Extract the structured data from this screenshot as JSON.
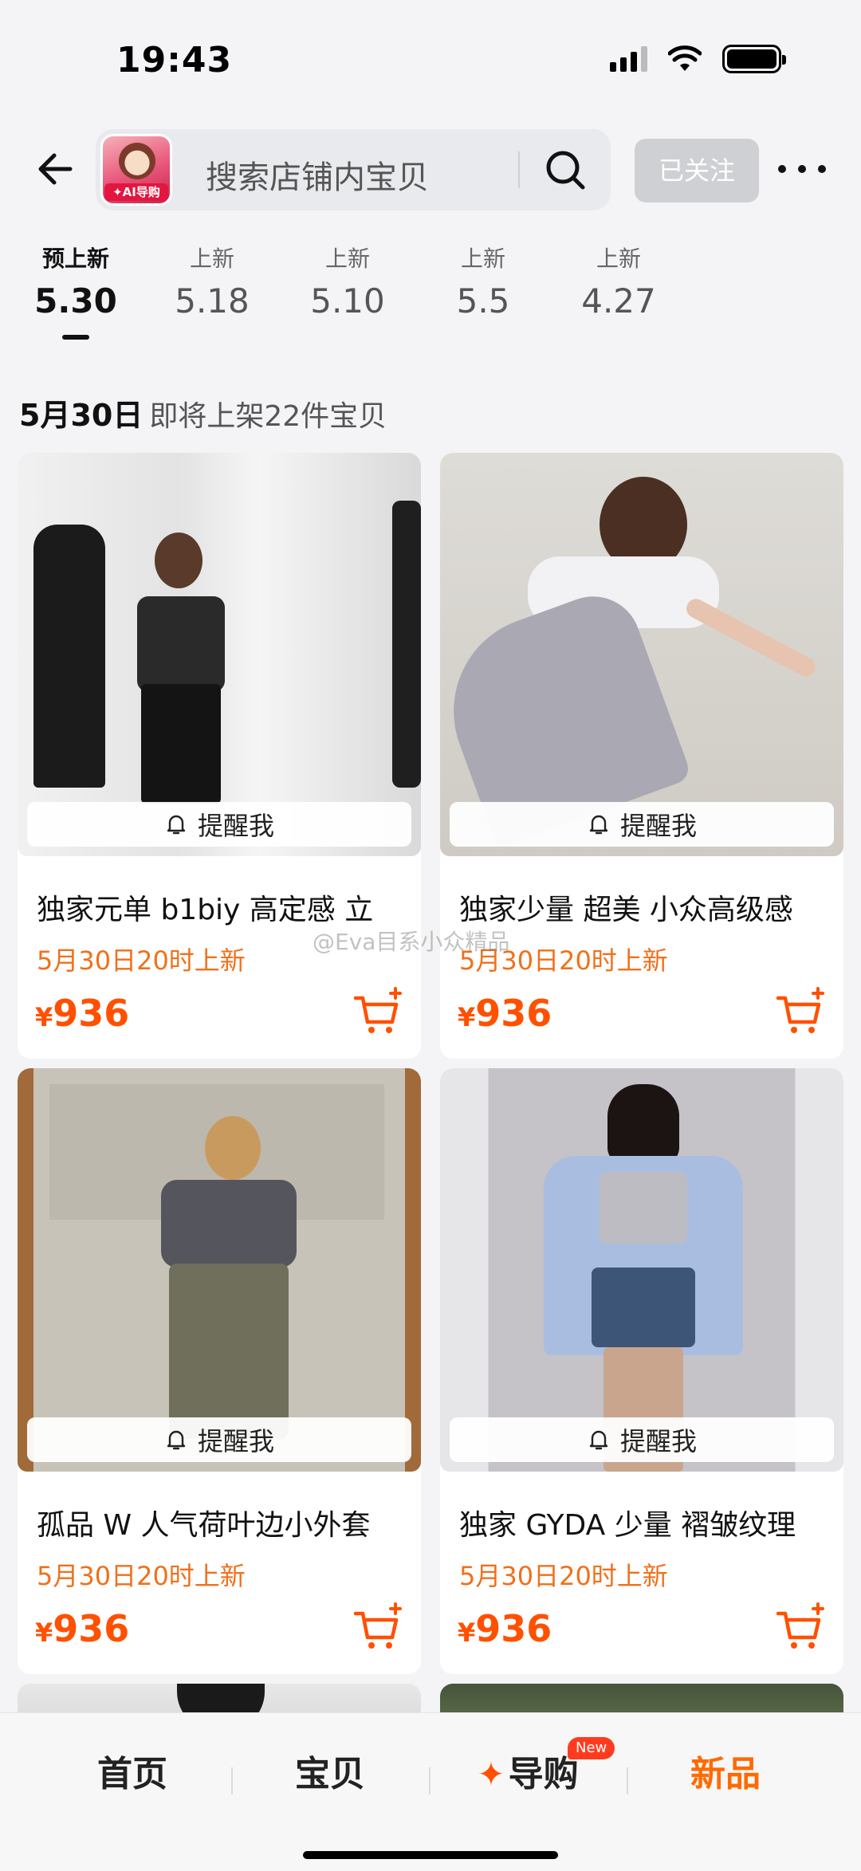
{
  "status_bar": {
    "time": "19:43"
  },
  "header": {
    "shop_logo_tag": "✦AI导购",
    "search_placeholder": "搜索店铺内宝贝",
    "follow_label": "已关注"
  },
  "date_tabs": [
    {
      "small": "预上新",
      "big": "5.30",
      "active": true
    },
    {
      "small": "上新",
      "big": "5.18",
      "active": false
    },
    {
      "small": "上新",
      "big": "5.10",
      "active": false
    },
    {
      "small": "上新",
      "big": "5.5",
      "active": false
    },
    {
      "small": "上新",
      "big": "4.27",
      "active": false
    }
  ],
  "section": {
    "date": "5月30日",
    "desc": "即将上架22件宝贝"
  },
  "remind_label": "提醒我",
  "products": [
    {
      "title": "独家元单 b1biy 高定感 立",
      "launch": "5月30日20时上新",
      "price_symbol": "¥",
      "price": "936"
    },
    {
      "title": "独家少量 超美 小众高级感",
      "launch": "5月30日20时上新",
      "price_symbol": "¥",
      "price": "936"
    },
    {
      "title": "孤品 W 人气荷叶边小外套",
      "launch": "5月30日20时上新",
      "price_symbol": "¥",
      "price": "936"
    },
    {
      "title": "独家 GYDA 少量 褶皱纹理",
      "launch": "5月30日20时上新",
      "price_symbol": "¥",
      "price": "936"
    }
  ],
  "watermark": "@Eva目系小众精品",
  "bottom_nav": {
    "home": "首页",
    "items": "宝贝",
    "guide": "导购",
    "guide_badge": "New",
    "new_arrivals": "新品"
  },
  "colors": {
    "accent": "#ff5000",
    "launch_text": "#f0701b",
    "active_nav": "#ff6a00"
  }
}
